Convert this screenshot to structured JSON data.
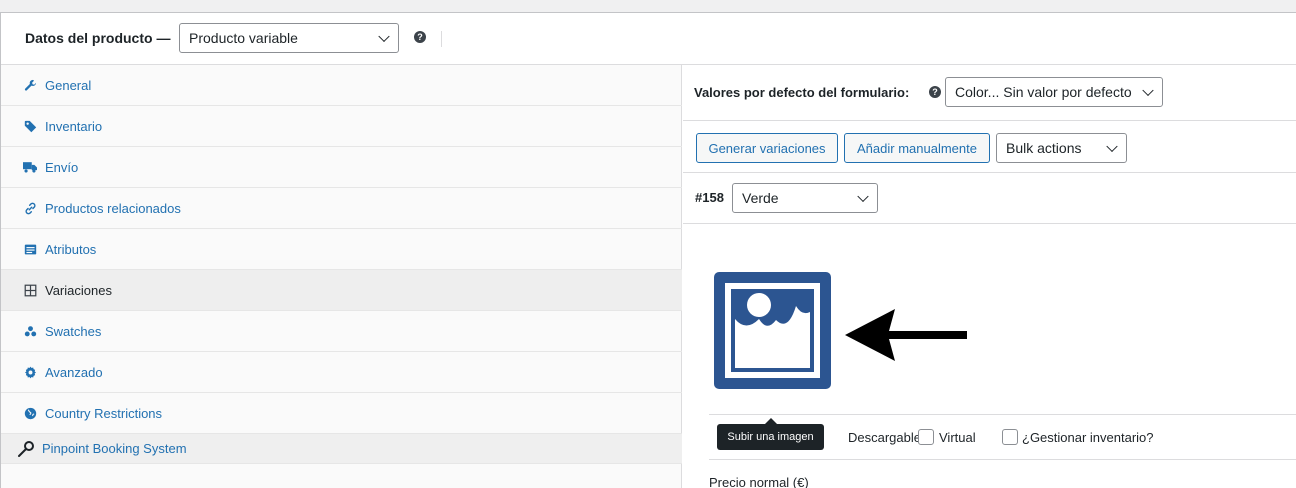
{
  "header": {
    "title": "Datos del producto —",
    "product_type": "Producto variable",
    "help": "?"
  },
  "sidebar": {
    "items": [
      {
        "label": "General",
        "icon": "wrench-icon"
      },
      {
        "label": "Inventario",
        "icon": "tag-icon"
      },
      {
        "label": "Envío",
        "icon": "truck-icon"
      },
      {
        "label": "Productos relacionados",
        "icon": "link-icon"
      },
      {
        "label": "Atributos",
        "icon": "list-icon"
      },
      {
        "label": "Variaciones",
        "icon": "grid-icon",
        "active": true
      },
      {
        "label": "Swatches",
        "icon": "dots-icon"
      },
      {
        "label": "Avanzado",
        "icon": "gear-icon"
      },
      {
        "label": "Country Restrictions",
        "icon": "globe-icon"
      },
      {
        "label": "Pinpoint Booking System",
        "icon": "pin-icon"
      }
    ]
  },
  "main": {
    "defaults_label": "Valores por defecto del formulario:",
    "defaults_value": "Color... Sin valor por defecto",
    "generate_button": "Generar variaciones",
    "add_manual_button": "Añadir manualmente",
    "bulk_actions": "Bulk actions",
    "variation_id": "#158",
    "variation_value": "Verde",
    "tooltip": "Subir una imagen",
    "checkboxes": {
      "downloadable": "Descargable",
      "virtual": "Virtual",
      "manage_stock": "¿Gestionar inventario?"
    },
    "price_label": "Precio normal (€)"
  },
  "colors": {
    "link": "#2271b1",
    "image_placeholder": "#2c5591"
  }
}
